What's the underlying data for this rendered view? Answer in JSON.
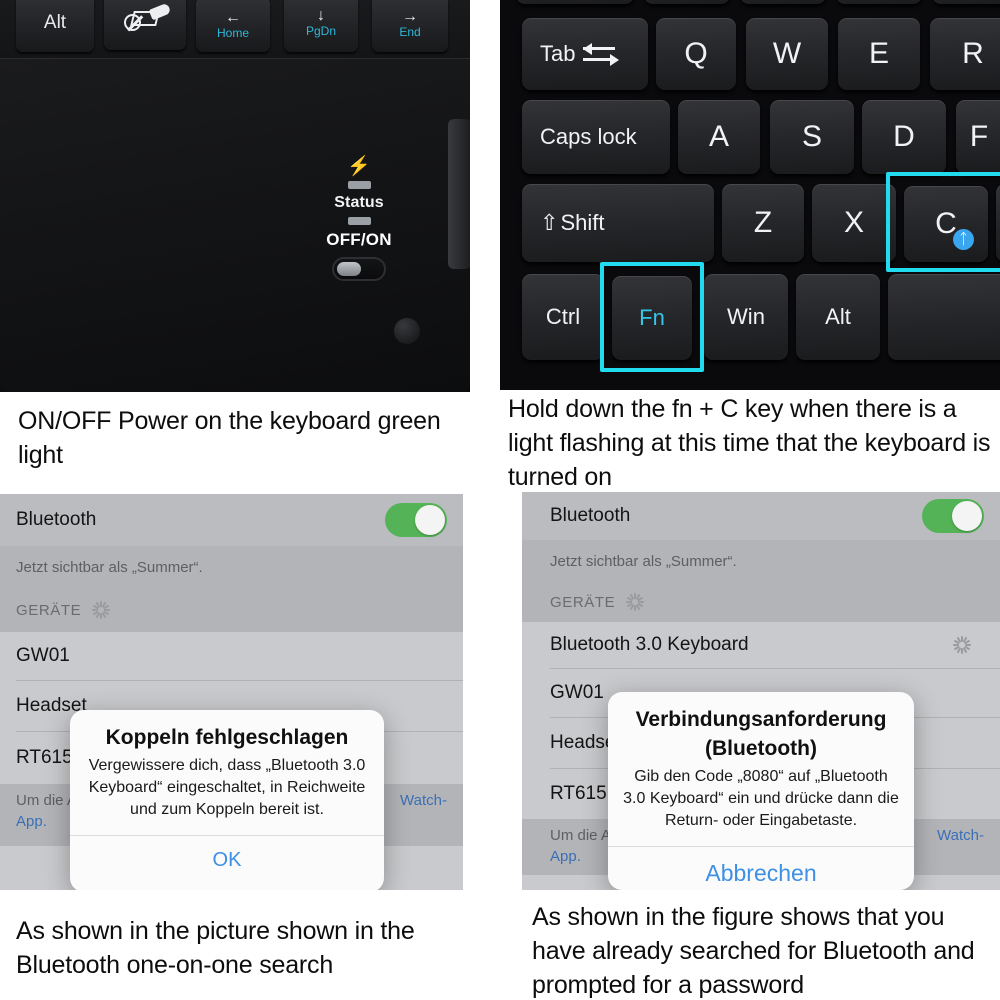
{
  "captions": {
    "top_left": "ON/OFF Power on the keyboard green light",
    "top_right": "Hold down the fn + C key when there is a light flashing at this time that the keyboard is turned on",
    "bottom_left": "As shown in the picture shown in the Bluetooth one-on-one search",
    "bottom_right": "As shown in the figure shows that you have already searched for Bluetooth and prompted for a password"
  },
  "keyboard_left": {
    "keys": [
      {
        "label": "Alt"
      },
      {
        "label": "touchpad-disable-icon"
      },
      {
        "arrow": "←",
        "sub": "Home"
      },
      {
        "arrow": "↓",
        "sub": "PgDn"
      },
      {
        "arrow": "→",
        "sub": "End"
      }
    ],
    "indicator": {
      "charge_icon": "lightning-bolt-icon",
      "status_label": "Status",
      "power_label": "OFF/ON"
    }
  },
  "keyboard_right": {
    "row_tab": [
      "Tab",
      "Q",
      "W",
      "E",
      "R"
    ],
    "row_caps": [
      "Caps lock",
      "A",
      "S",
      "D",
      "F"
    ],
    "row_shift": [
      "Shift",
      "Z",
      "X",
      "C"
    ],
    "row_ctrl": [
      "Ctrl",
      "Fn",
      "Win",
      "Alt"
    ],
    "shift_prefix": "⇧",
    "highlighted_keys": [
      "C",
      "Fn"
    ],
    "bluetooth_badge_on": "C",
    "highlight_color": "#23dbee"
  },
  "bluetooth_left": {
    "header": {
      "label": "Bluetooth",
      "toggle_on": true
    },
    "subtitle": "Jetzt sichtbar als „Summer“.",
    "devices_header": "GERÄTE",
    "devices": [
      "GW01",
      "Headset",
      "RT615"
    ],
    "footer_text": "Um die Ap",
    "footer_link": "Watch-",
    "footer_link2": "App.",
    "dialog": {
      "title": "Koppeln fehlgeschlagen",
      "message": "Vergewissere dich, dass „Bluetooth 3.0 Keyboard“ eingeschaltet, in Reichweite und zum Koppeln bereit ist.",
      "action": "OK"
    }
  },
  "bluetooth_right": {
    "header": {
      "label": "Bluetooth",
      "toggle_on": true
    },
    "subtitle": "Jetzt sichtbar als „Summer“.",
    "devices_header": "GERÄTE",
    "devices": [
      "Bluetooth 3.0 Keyboard",
      "GW01",
      "Headset",
      "RT615"
    ],
    "footer_text": "Um die Ap",
    "footer_link": "Watch-",
    "footer_link2": "App.",
    "dialog": {
      "title_line1": "Verbindungsanforderung",
      "title_line2": "(Bluetooth)",
      "message": "Gib den Code „8080“ auf „Bluetooth 3.0 Keyboard“ ein und drücke dann die Return- oder Eingabetaste.",
      "action": "Abbrechen",
      "pair_code": "8080"
    }
  },
  "colors": {
    "toggle_green": "#54b356",
    "highlight_cyan": "#23dbee",
    "ios_blue": "#3d90e3",
    "fn_cyan": "#35c6e8",
    "bluetooth_blue": "#3aa6f0"
  }
}
